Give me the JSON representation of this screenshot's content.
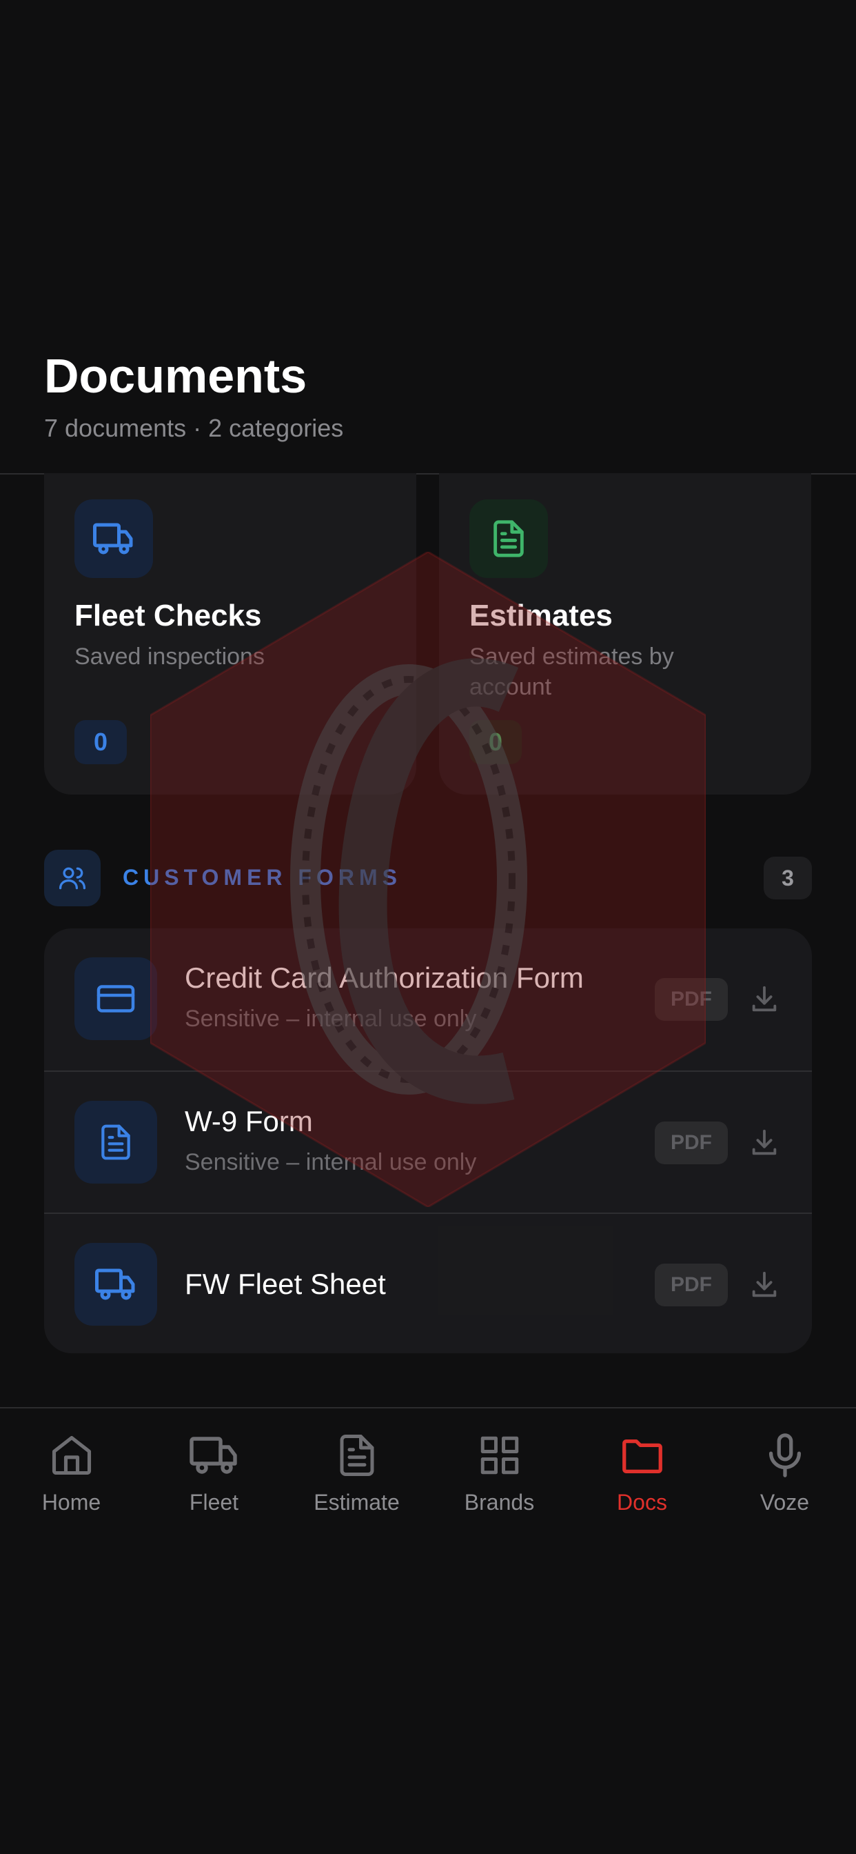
{
  "header": {
    "title": "Documents",
    "subtitle": "7 documents · 2 categories"
  },
  "cards": [
    {
      "title": "Fleet Checks",
      "description": "Saved inspections",
      "count": "0",
      "icon": "truck-icon",
      "accent": "#3b82e6"
    },
    {
      "title": "Estimates",
      "description": "Saved estimates by account",
      "count": "0",
      "icon": "document-icon",
      "accent": "#3fb56a"
    }
  ],
  "section": {
    "label": "CUSTOMER FORMS",
    "count": "3",
    "icon": "users-icon"
  },
  "forms": [
    {
      "title": "Credit Card Authorization Form",
      "subtitle": "Sensitive – internal use only",
      "badge": "PDF",
      "icon": "credit-card-icon"
    },
    {
      "title": "W-9 Form",
      "subtitle": "Sensitive – internal use only",
      "badge": "PDF",
      "icon": "document-icon"
    },
    {
      "title": "FW Fleet Sheet",
      "subtitle": "",
      "badge": "PDF",
      "icon": "truck-icon"
    }
  ],
  "tabs": [
    {
      "label": "Home",
      "icon": "home-icon",
      "active": false
    },
    {
      "label": "Fleet",
      "icon": "truck-icon",
      "active": false
    },
    {
      "label": "Estimate",
      "icon": "document-icon",
      "active": false
    },
    {
      "label": "Brands",
      "icon": "grid-icon",
      "active": false
    },
    {
      "label": "Docs",
      "icon": "folder-icon",
      "active": true
    },
    {
      "label": "Voze",
      "icon": "microphone-icon",
      "active": false
    }
  ],
  "colors": {
    "background": "#0f0f10",
    "accent_blue": "#3b82e6",
    "accent_green": "#3fb56a",
    "active_tab": "#e0302b",
    "watermark_red": "#8b1a1a"
  }
}
